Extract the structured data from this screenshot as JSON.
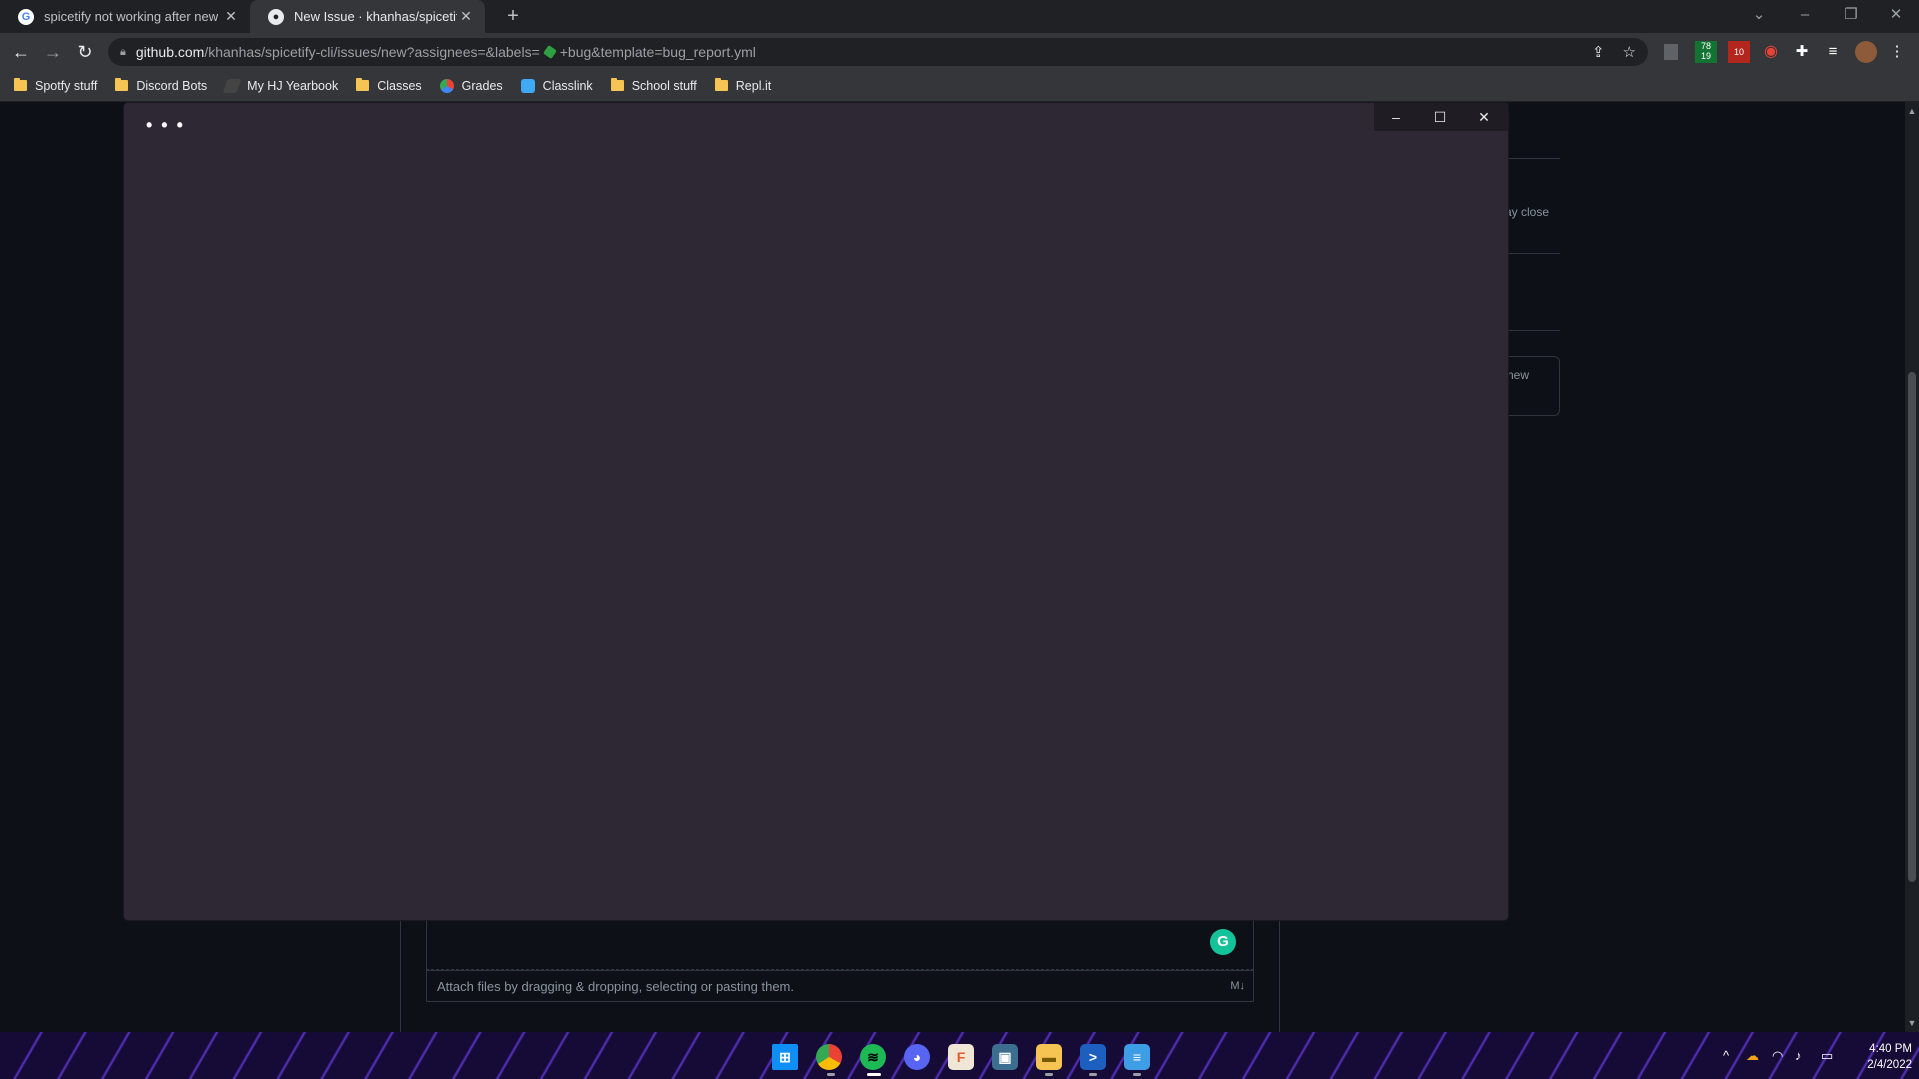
{
  "browser": {
    "tabs": [
      {
        "title": "spicetify not working after new s",
        "favicon": "google-icon"
      },
      {
        "title": "New Issue · khanhas/spicetify-cli",
        "favicon": "github-icon"
      }
    ],
    "url": {
      "host": "github.com",
      "path_a": "/khanhas/spicetify-cli/issues/new?assignees=&labels=",
      "path_b": "+bug&template=bug_report.yml"
    },
    "extensions": [
      {
        "name": "extension-1",
        "badge": ""
      },
      {
        "name": "extension-2",
        "badge": "78 19"
      },
      {
        "name": "extension-3",
        "badge": "10"
      }
    ],
    "bookmarks": [
      {
        "label": "Spotfy stuff",
        "icon": "folder-icon"
      },
      {
        "label": "Discord Bots",
        "icon": "folder-icon"
      },
      {
        "label": "My HJ Yearbook",
        "icon": "yearbook-icon"
      },
      {
        "label": "Classes",
        "icon": "folder-icon"
      },
      {
        "label": "Grades",
        "icon": "grades-icon"
      },
      {
        "label": "Classlink",
        "icon": "classlink-icon"
      },
      {
        "label": "School stuff",
        "icon": "folder-icon"
      },
      {
        "label": "Repl.it",
        "icon": "folder-icon"
      }
    ]
  },
  "page": {
    "side_text_1": "ay close",
    "side_text_2": "new",
    "attach_text": "Attach files by dragging & dropping, selecting or pasting them.",
    "grammarly_letter": "G"
  },
  "modal": {
    "menu_dots": "• • •"
  },
  "taskbar": {
    "apps": [
      "windows-start-icon",
      "chrome-icon",
      "spotify-icon",
      "discord-icon",
      "figma-icon",
      "photo-icon",
      "file-explorer-icon",
      "powershell-icon",
      "notepad-icon"
    ],
    "clock_time": "4:40 PM",
    "clock_date": "2/4/2022"
  },
  "colors": {
    "accent_green": "#2ea043",
    "grammarly": "#15c39a",
    "modal_bg": "#2d2833"
  }
}
